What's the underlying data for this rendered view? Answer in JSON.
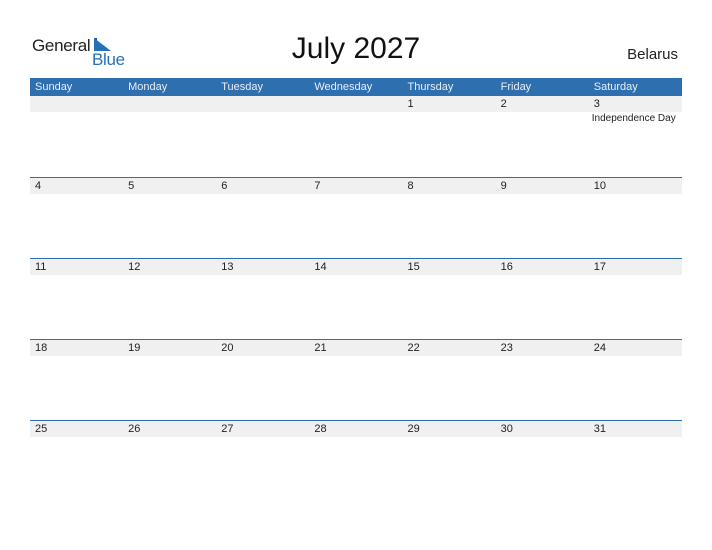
{
  "logo": {
    "general": "General",
    "blue": "Blue",
    "brand_color": "#2471b8"
  },
  "title": "July 2027",
  "country": "Belarus",
  "header_color": "#2e6fb0",
  "weekdays": [
    "Sunday",
    "Monday",
    "Tuesday",
    "Wednesday",
    "Thursday",
    "Friday",
    "Saturday"
  ],
  "weeks": [
    {
      "days": [
        "",
        "",
        "",
        "",
        "1",
        "2",
        "3"
      ],
      "events": [
        "",
        "",
        "",
        "",
        "",
        "",
        "Independence Day"
      ]
    },
    {
      "days": [
        "4",
        "5",
        "6",
        "7",
        "8",
        "9",
        "10"
      ],
      "events": [
        "",
        "",
        "",
        "",
        "",
        "",
        ""
      ]
    },
    {
      "days": [
        "11",
        "12",
        "13",
        "14",
        "15",
        "16",
        "17"
      ],
      "events": [
        "",
        "",
        "",
        "",
        "",
        "",
        ""
      ]
    },
    {
      "days": [
        "18",
        "19",
        "20",
        "21",
        "22",
        "23",
        "24"
      ],
      "events": [
        "",
        "",
        "",
        "",
        "",
        "",
        ""
      ]
    },
    {
      "days": [
        "25",
        "26",
        "27",
        "28",
        "29",
        "30",
        "31"
      ],
      "events": [
        "",
        "",
        "",
        "",
        "",
        "",
        ""
      ]
    }
  ]
}
